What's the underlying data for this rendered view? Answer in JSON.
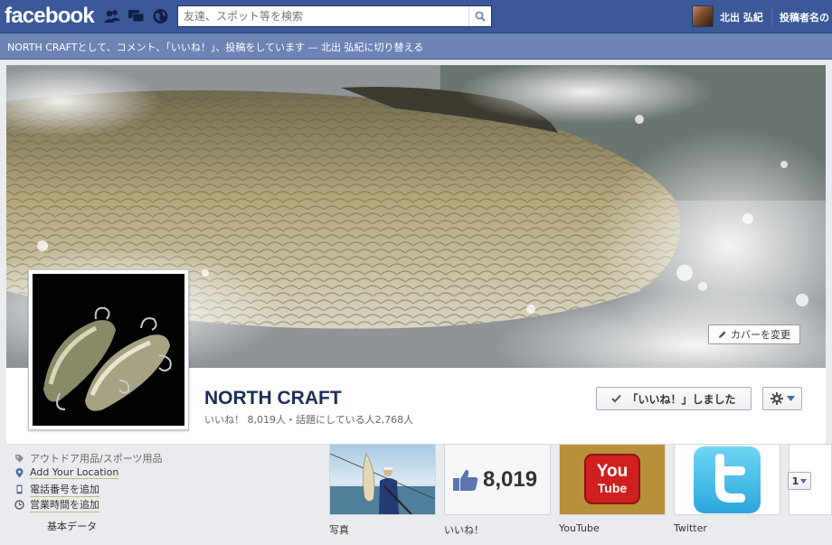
{
  "topbar": {
    "logo": "facebook",
    "search_placeholder": "友達、スポット等を検索",
    "user_name": "北出 弘紀",
    "posting_as": "投稿者名の"
  },
  "voice": {
    "message": "NORTH CRAFTとして、コメント、「いいね！」、投稿をしています — ",
    "switch_link": "北出 弘紀に切り替える"
  },
  "cover": {
    "change_cover_label": "カバーを変更"
  },
  "page": {
    "name": "NORTH CRAFT",
    "stats": "いいね！ 8,019人・話題にしている人2,768人",
    "like_button": "「いいね！」しました"
  },
  "info": {
    "category": "アウトドア用品/スポーツ用品",
    "location": "Add Your Location",
    "phone": "電話番号を追加",
    "hours": "営業時間を追加",
    "basic_data": "基本データ"
  },
  "apps": [
    {
      "label": "写真"
    },
    {
      "label": "いいね！",
      "count": "8,019"
    },
    {
      "label": "YouTube",
      "logo_top": "You",
      "logo_bottom": "Tube"
    },
    {
      "label": "Twitter"
    }
  ],
  "more": {
    "count": "1"
  }
}
